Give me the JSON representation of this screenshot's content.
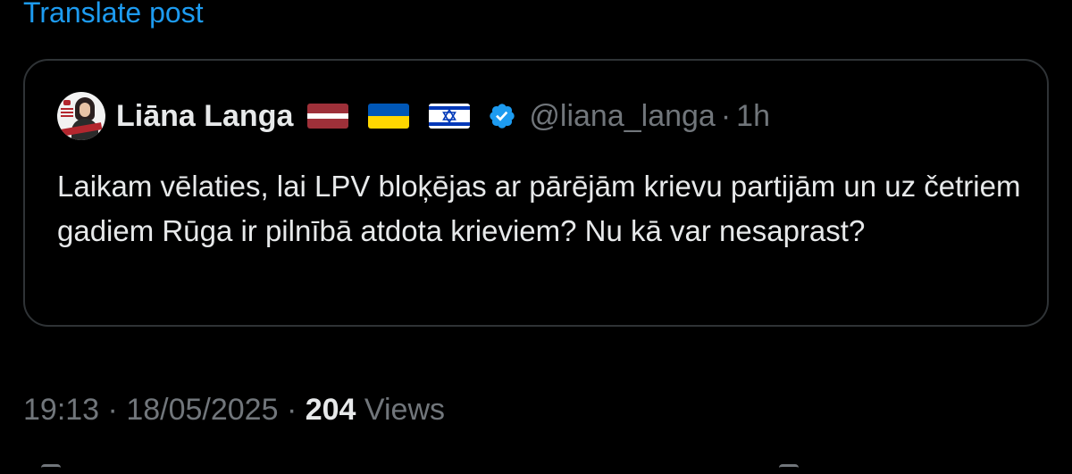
{
  "translate": {
    "label": "Translate post"
  },
  "quote": {
    "author_name": "Liāna Langa",
    "flags": [
      "latvia-flag",
      "ukraine-flag",
      "israel-flag"
    ],
    "verified_icon": "verified-badge-icon",
    "handle": "@liana_langa",
    "separator": "·",
    "time_ago": "1h",
    "text": "Laikam vēlaties, lai LPV bloķējas ar pārējām krievu partijām un uz četriem gadiem Rūga ir pilnībā atdota krieviem? Nu kā var nesaprast?"
  },
  "meta": {
    "time": "19:13",
    "date": "18/05/2025",
    "separator": "·",
    "views_count": "204",
    "views_label": "Views"
  },
  "colors": {
    "background": "#000000",
    "link": "#1d9bf0",
    "text_primary": "#e7e9ea",
    "text_secondary": "#71767b",
    "border": "#2f3336",
    "verified": "#1d9bf0"
  }
}
